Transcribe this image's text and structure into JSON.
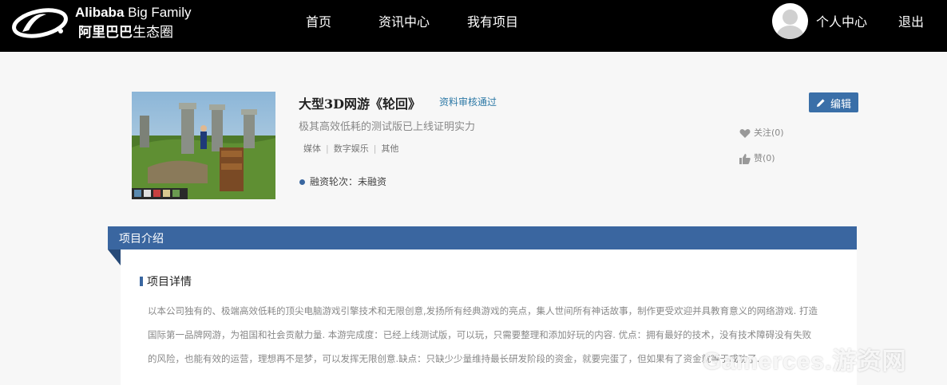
{
  "header": {
    "logo_en_bold": "Alibaba",
    "logo_en_rest": " Big Family",
    "logo_cn_bold": "阿里巴巴",
    "logo_cn_rest": "生态圈",
    "nav": [
      {
        "label": "首页"
      },
      {
        "label": "资讯中心"
      },
      {
        "label": "我有项目"
      }
    ],
    "user_center": "个人中心",
    "logout": "退出"
  },
  "project": {
    "title": "大型3D网游《轮回》",
    "status": "资料审核通过",
    "subtitle": "极其高效低耗的测试版已上线证明实力",
    "tags": [
      "媒体",
      "数字娱乐",
      "其他"
    ],
    "funding_label": "融资轮次：未融资",
    "edit_label": "编辑",
    "follow_label": "关注(0)",
    "like_label": "赞(0)"
  },
  "intro": {
    "section_title": "项目介绍",
    "detail_title": "项目详情",
    "detail_text": "以本公司独有的、极端高效低耗的顶尖电脑游戏引擎技术和无限创意,发扬所有经典游戏的亮点，集人世间所有神话故事，制作更受欢迎并具教育意义的网络游戏. 打造国际第一品牌网游，为祖国和社会贡献力量. 本游完成度：已经上线测试版，可以玩，只需要整理和添加好玩的内容. 优点：拥有最好的技术，没有技术障碍没有失败的风险，也能有效的运营，理想再不是梦，可以发挥无限创意.缺点：只缺少少量维持最长研发阶段的资金，就要完蛋了，但如果有了资金就等于成功了."
  },
  "watermark": "Gamerces.游资网",
  "colors": {
    "header_bg": "#000000",
    "accent_blue": "#3a66a0",
    "status_blue": "#2d79a6",
    "page_bg": "#f7f7f7"
  }
}
